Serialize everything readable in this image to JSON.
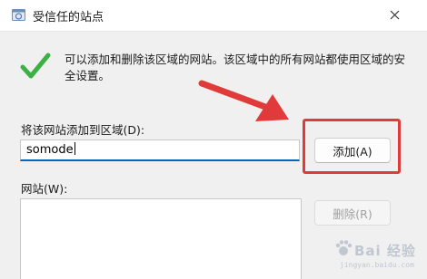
{
  "window": {
    "title": "受信任的站点",
    "icon": "globe-shield-icon",
    "close_icon": "close-icon"
  },
  "info": {
    "icon": "green-check-icon",
    "text": "可以添加和删除该区域的网站。该区域中的所有网站都使用区域的安全设置。"
  },
  "add_site": {
    "label": "将该网站添加到区域(D):",
    "input_value": "somode",
    "button_label": "添加(A)"
  },
  "sites": {
    "label": "网站(W):",
    "items": [],
    "remove_label": "删除(R)"
  },
  "annotation": {
    "arrow_color": "#e03a3a",
    "highlight_color": "#e03a3a"
  },
  "watermark": {
    "text": "Bai 经验",
    "subtext": "jingyan.baidu.com"
  },
  "colors": {
    "accent": "#0067c0",
    "check": "#3cb043",
    "annotation_red": "#e03a3a"
  }
}
